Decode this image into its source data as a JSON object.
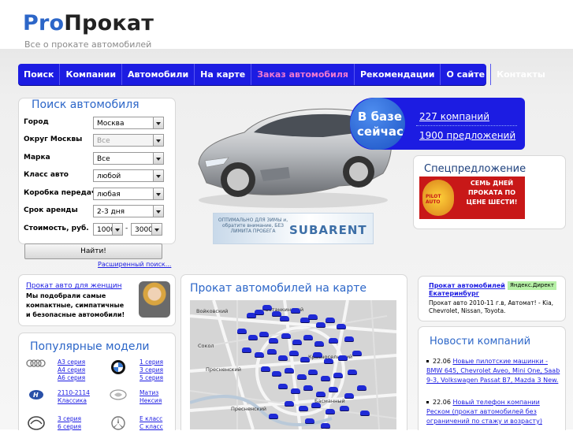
{
  "header": {
    "logo_part1": "Pro",
    "logo_part2": "Прокат",
    "tagline": "Все о прокате автомобилей"
  },
  "nav": {
    "items": [
      "Поиск",
      "Компании",
      "Автомобили",
      "На карте",
      "Заказ автомобиля",
      "Рекомендации",
      "О сайте",
      "Контакты"
    ],
    "active_index": 4
  },
  "search": {
    "title": "Поиск автомобиля",
    "fields": [
      {
        "label": "Город",
        "value": "Москва",
        "disabled": false
      },
      {
        "label": "Округ Москвы",
        "value": "Все",
        "disabled": true
      },
      {
        "label": "Марка",
        "value": "Все",
        "disabled": false
      },
      {
        "label": "Класс авто",
        "value": "любой",
        "disabled": false
      },
      {
        "label": "Коробка передач",
        "value": "любая",
        "disabled": false
      },
      {
        "label": "Срок аренды",
        "value": "2-3 дня",
        "disabled": false
      }
    ],
    "cost_label": "Стоимость, руб.",
    "cost_from": "1000",
    "cost_separator": "-",
    "cost_to": "3000",
    "find_button": "Найти!",
    "advanced_link": "Расширенный поиск..."
  },
  "stats": {
    "badge_line1": "В базе",
    "badge_line2": "сейчас",
    "companies": "227 компаний",
    "offers": "1900 предложений"
  },
  "banner": {
    "left_text": "ОПТИМАЛЬНО ДЛЯ ЗИМЫ и, обратите внимание, БЕЗ ЛИМИТА ПРОБЕГА",
    "brand": "SUBARENT"
  },
  "special": {
    "title": "Спецпредложение",
    "text": "СЕМЬ ДНЕЙ ПРОКАТА ПО ЦЕНЕ ШЕСТИ!",
    "logo_text": "PILOT AUTO"
  },
  "women": {
    "link": "Прокат авто для женщин",
    "desc": [
      "Мы подобрали самые",
      "компактные, симпатичные",
      "и безопасные автомобили!"
    ]
  },
  "popular": {
    "title": "Популярные модели",
    "rows": [
      {
        "icon_left": "audi-logo-icon",
        "left": [
          "A3 серия",
          "A4 серия",
          "A6 серия"
        ],
        "icon_right": "bmw-logo-icon",
        "right": [
          "1 серия",
          "3 серия",
          "5 серия"
        ]
      },
      {
        "icon_left": "hyundai-logo-icon",
        "left": [
          "2110-2114",
          "Классика"
        ],
        "icon_right": "daewoo-logo-icon",
        "right": [
          "Матиз",
          "Нексия"
        ]
      },
      {
        "icon_left": "mazda-logo-icon",
        "left": [
          "3 серия",
          "6 серия"
        ],
        "icon_right": "mercedes-logo-icon",
        "right": [
          "E класс",
          "C класс"
        ]
      }
    ]
  },
  "map": {
    "title": "Прокат автомобилей на карте",
    "labels": [
      "Войковский",
      "Останкинский",
      "Сокол",
      "Пресненский",
      "Красносельский",
      "Басманный",
      "Пресненский"
    ]
  },
  "ad": {
    "title": "Прокат автомобилей Екатеринбург",
    "badge": "Яндекс.Директ",
    "desc": "Прокат авто 2010-11 г.в, Автомат! - Kia, Chevrolet, Nissan, Toyota."
  },
  "news": {
    "title": "Новости компаний",
    "items": [
      {
        "date": "22.06",
        "text": "Новые пилотские машинки - BMW 645, Chevrolet Aveo, Mini One, Saab 9-3, Volkswagen Passat B7, Mazda 3 New."
      },
      {
        "date": "22.06",
        "text": "Новый телефон компании Реском (прокат автомобилей без ограничений по стажу и возрасту)"
      }
    ]
  },
  "colors": {
    "nav_bg": "#1c1ce2",
    "brand_blue": "#2c66c8",
    "active_pink": "#f07ad0"
  }
}
